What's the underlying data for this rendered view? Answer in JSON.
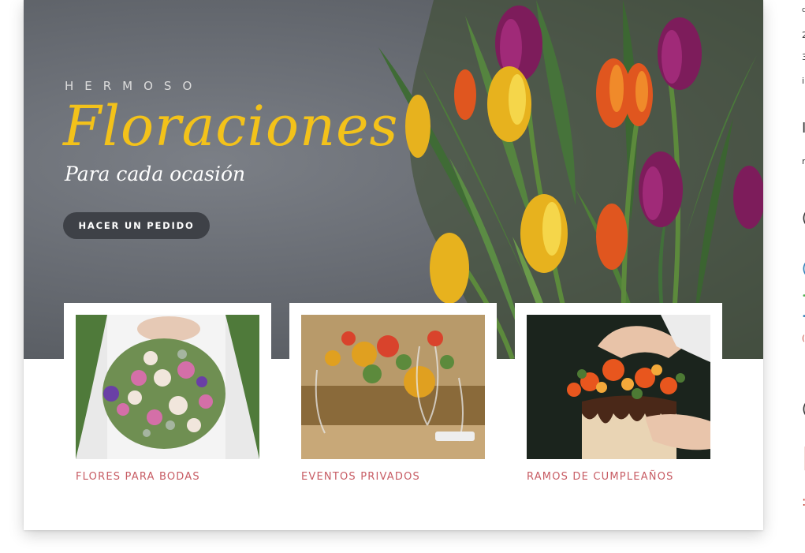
{
  "hero": {
    "kicker": "HERMOSO",
    "headline": "Floraciones",
    "tagline": "Para cada ocasión",
    "cta_label": "HACER UN PEDIDO"
  },
  "tiles": [
    {
      "caption": "FLORES PARA BODAS",
      "image": "bridal-bouquet-photo"
    },
    {
      "caption": "EVENTOS PRIVADOS",
      "image": "event-table-flowers-photo"
    },
    {
      "caption": "RAMOS DE CUMPLEAÑOS",
      "image": "birthday-cake-flowers-photo"
    }
  ],
  "colors": {
    "accent_yellow": "#f3c21a",
    "button_dark": "#3e4147",
    "caption_red": "#c75b63",
    "hero_gray": "#676b72"
  }
}
